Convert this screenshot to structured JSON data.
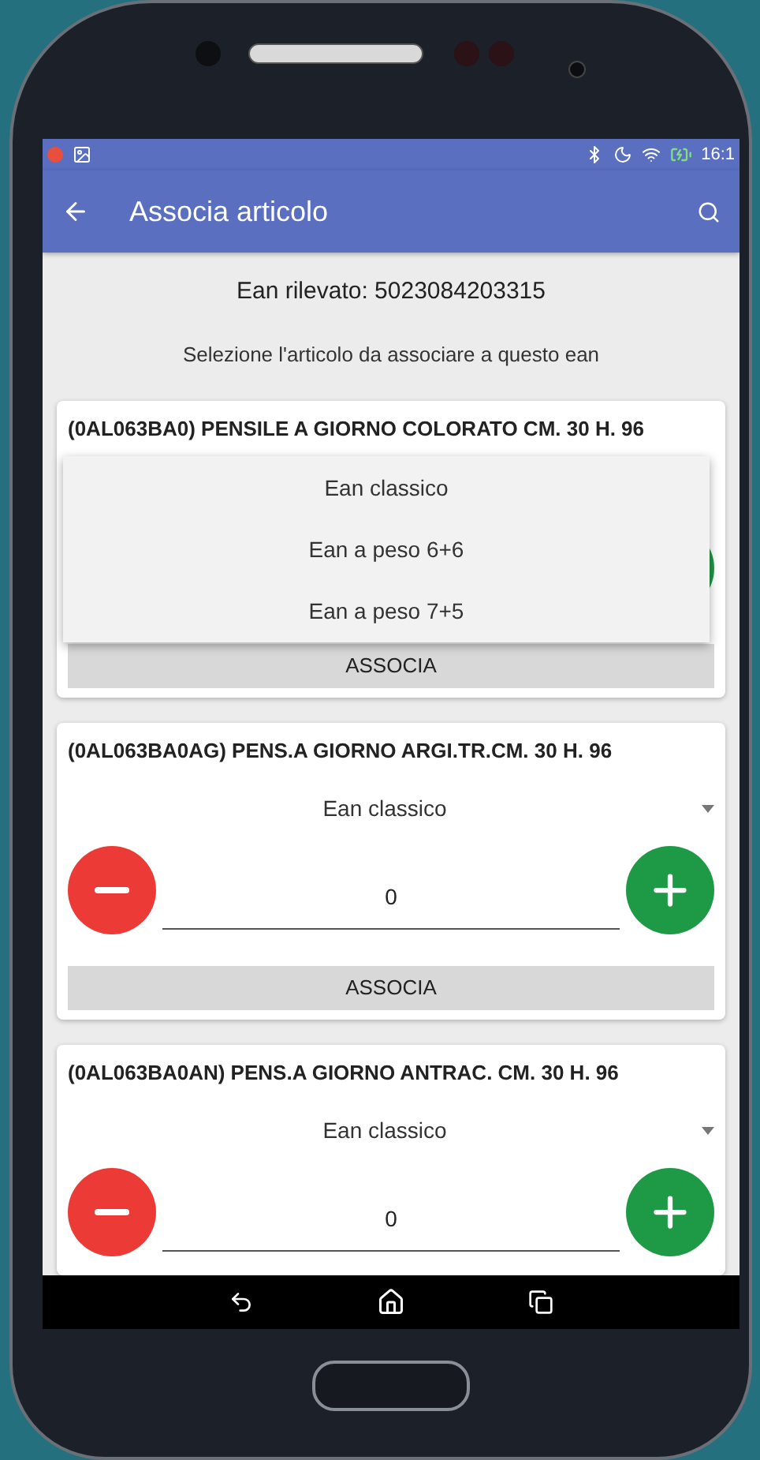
{
  "status_bar": {
    "time": "16:1"
  },
  "app_bar": {
    "title": "Associa articolo"
  },
  "ean_label": "Ean rilevato: 5023084203315",
  "instruction": "Selezione l'articolo da associare a questo ean",
  "articles": [
    {
      "title": "(0AL063BA0) PENSILE A GIORNO COLORATO CM. 30 H. 96",
      "dropdown_options": [
        "Ean classico",
        "Ean a peso 6+6",
        "Ean a peso 7+5"
      ],
      "button": "ASSOCIA"
    },
    {
      "title": "(0AL063BA0AG) PENS.A GIORNO ARGI.TR.CM. 30 H. 96",
      "ean_type": "Ean classico",
      "quantity": "0",
      "button": "ASSOCIA"
    },
    {
      "title": "(0AL063BA0AN) PENS.A GIORNO ANTRAC. CM. 30 H. 96",
      "ean_type": "Ean classico",
      "quantity": "0"
    }
  ]
}
